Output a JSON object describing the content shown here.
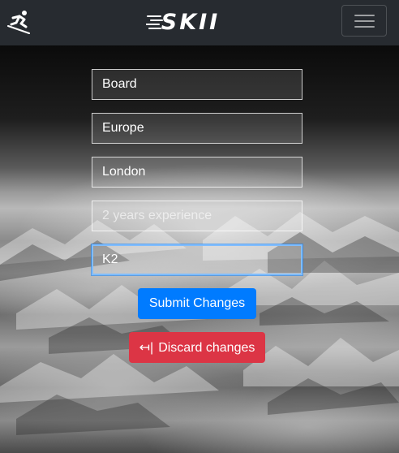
{
  "navbar": {
    "logo_icon": "skier-icon",
    "brand": "SKII",
    "menu_icon": "hamburger-menu-icon"
  },
  "form": {
    "fields": [
      {
        "value": "Board",
        "placeholder": ""
      },
      {
        "value": "Europe",
        "placeholder": ""
      },
      {
        "value": "London",
        "placeholder": ""
      },
      {
        "value": "",
        "placeholder": "2 years experience"
      },
      {
        "value": "K2",
        "placeholder": ""
      }
    ],
    "submit_label": "Submit Changes",
    "discard_icon": "arrow-left-to-bar-icon",
    "discard_icon_glyph": "↤|",
    "discard_label": "Discard changes"
  },
  "colors": {
    "navbar_bg": "#272b30",
    "primary": "#007bff",
    "danger": "#dc3545",
    "focus": "#80bdff"
  }
}
